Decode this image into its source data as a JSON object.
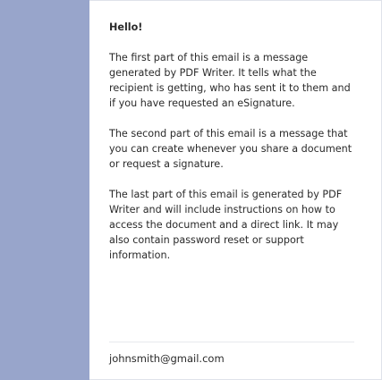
{
  "email": {
    "greeting": "Hello!",
    "paragraphs": [
      "The first part of this email is a message generated by PDF Writer. It tells what the recipient is getting, who has sent it to them and if you have requested an eSignature.",
      "The second part of this email is a message that you can create whenever you share a document or request a signature.",
      "The last part of this email is generated by PDF Writer and will include instructions on how to access the document and a direct link. It may also contain password reset or support information."
    ],
    "sender_email": "johnsmith@gmail.com"
  },
  "colors": {
    "sidebar": "#98a5cb",
    "panel_border": "#dfe2ea",
    "text": "#2a2a2a"
  }
}
